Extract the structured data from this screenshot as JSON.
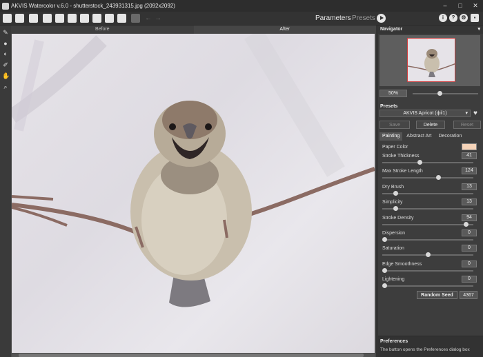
{
  "window": {
    "title": "AKVIS Watercolor v.6.0 - shutterstock_243931315.jpg (2092x2092)"
  },
  "toolbar": {
    "parameters_label": "Parameters",
    "presets_label": "Presets",
    "buttons": [
      "open-icon",
      "save-icon",
      "save-as-icon",
      "print-icon",
      "share-icon",
      "batch-icon",
      "plugin-icon",
      "export-icon",
      "import-icon",
      "settings-icon",
      "check-icon",
      "apply-icon"
    ]
  },
  "canvas": {
    "tab_before": "Before",
    "tab_after": "After",
    "active_tab": "After"
  },
  "navigator": {
    "title": "Navigator",
    "zoom": "50%"
  },
  "presets": {
    "title": "Presets",
    "selected": "AKVIS Apricot (фil1)",
    "save_label": "Save",
    "delete_label": "Delete",
    "reset_label": "Reset"
  },
  "effect_tabs": {
    "painting": "Painting",
    "abstract_art": "Abstract Art",
    "decoration": "Decoration",
    "active": "Painting"
  },
  "parameters": {
    "paper_color": {
      "label": "Paper Color",
      "color": "#f5d3b8"
    },
    "items": [
      {
        "label": "Stroke Thickness",
        "value": "41"
      },
      {
        "label": "Max Stroke Length",
        "value": "124"
      },
      {
        "label": "Dry Brush",
        "value": "13"
      },
      {
        "label": "Simplicity",
        "value": "13"
      },
      {
        "label": "Stroke Density",
        "value": "94"
      },
      {
        "label": "Dispersion",
        "value": "0"
      },
      {
        "label": "Saturation",
        "value": "0"
      },
      {
        "label": "Edge Smoothness",
        "value": "0"
      },
      {
        "label": "Lightening",
        "value": "0"
      }
    ],
    "levels": [
      0.41,
      0.62,
      0.13,
      0.13,
      0.94,
      0.0,
      0.5,
      0.0,
      0.0
    ]
  },
  "seed": {
    "button_label": "Random Seed",
    "value": "4367"
  },
  "preferences": {
    "title": "Preferences",
    "text": "The button opens the Preferences dialog box"
  }
}
